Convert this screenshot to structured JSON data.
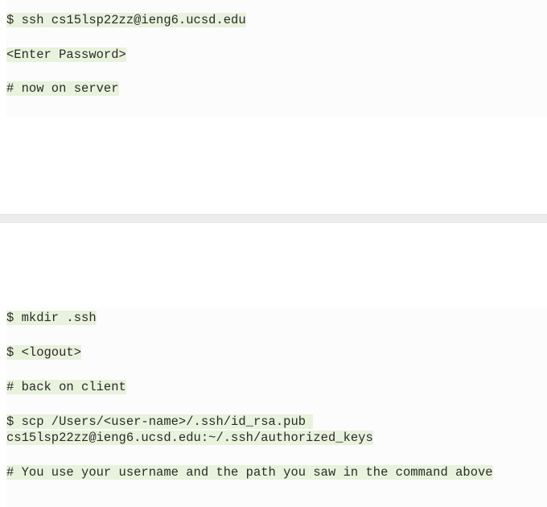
{
  "block1": {
    "lines": [
      "$ ssh cs15lsp22zz@ieng6.ucsd.edu",
      "<Enter Password>",
      "# now on server"
    ]
  },
  "block2": {
    "lines": [
      "$ mkdir .ssh",
      "$ <logout>",
      "# back on client",
      "$ scp /Users/<user-name>/.ssh/id_rsa.pub cs15lsp22zz@ieng6.ucsd.edu:~/.ssh/authorized_keys",
      "# You use your username and the path you saw in the command above"
    ]
  },
  "colors": {
    "line_highlight": "#e8f2dc",
    "block_background": "#fcfcfc",
    "divider": "#ececec"
  }
}
